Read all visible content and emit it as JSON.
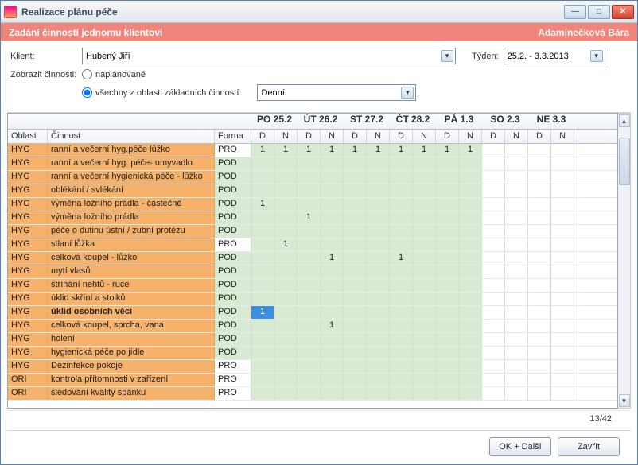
{
  "window": {
    "title": "Realizace plánu péče"
  },
  "subheader": {
    "left": "Zadání činností jednomu klientovi",
    "right": "Adamínečková Bára"
  },
  "form": {
    "client_label": "Klient:",
    "client_value": "Hubený Jiří",
    "week_label": "Týden:",
    "week_value": "25.2. - 3.3.2013",
    "show_label": "Zobrazit činnosti:",
    "radio_planned": "naplánované",
    "radio_all": "všechny z oblasti základních činností:",
    "area_value": "Denní"
  },
  "grid": {
    "days": [
      "PO 25.2",
      "ÚT 26.2",
      "ST 27.2",
      "ČT 28.2",
      "PÁ 1.3",
      "SO 2.3",
      "NE 3.3"
    ],
    "subcols": [
      "D",
      "N"
    ],
    "headers": {
      "oblast": "Oblast",
      "cinnost": "Činnost",
      "forma": "Forma"
    },
    "rows": [
      {
        "oblast": "HYG",
        "cinnost": "ranní a večerní hyg.péče lůžko",
        "forma": "PRO",
        "vals": [
          "1",
          "1",
          "1",
          "1",
          "1",
          "1",
          "1",
          "1",
          "1",
          "1",
          "",
          "",
          "",
          ""
        ]
      },
      {
        "oblast": "HYG",
        "cinnost": "ranní a večerní hyg. péče- umyvadlo",
        "forma": "POD",
        "vals": [
          "",
          "",
          "",
          "",
          "",
          "",
          "",
          "",
          "",
          "",
          "",
          "",
          "",
          ""
        ]
      },
      {
        "oblast": "HYG",
        "cinnost": "ranní a večerní hygienická péče - lůžko",
        "forma": "POD",
        "vals": [
          "",
          "",
          "",
          "",
          "",
          "",
          "",
          "",
          "",
          "",
          "",
          "",
          "",
          ""
        ]
      },
      {
        "oblast": "HYG",
        "cinnost": "oblékání / svlékání",
        "forma": "POD",
        "vals": [
          "",
          "",
          "",
          "",
          "",
          "",
          "",
          "",
          "",
          "",
          "",
          "",
          "",
          ""
        ]
      },
      {
        "oblast": "HYG",
        "cinnost": "výměna ložního prádla - částečně",
        "forma": "POD",
        "vals": [
          "1",
          "",
          "",
          "",
          "",
          "",
          "",
          "",
          "",
          "",
          "",
          "",
          "",
          ""
        ]
      },
      {
        "oblast": "HYG",
        "cinnost": "výměna ložního prádla",
        "forma": "POD",
        "vals": [
          "",
          "",
          "1",
          "",
          "",
          "",
          "",
          "",
          "",
          "",
          "",
          "",
          "",
          ""
        ]
      },
      {
        "oblast": "HYG",
        "cinnost": "péče o dutinu ústní / zubní protézu",
        "forma": "POD",
        "vals": [
          "",
          "",
          "",
          "",
          "",
          "",
          "",
          "",
          "",
          "",
          "",
          "",
          "",
          ""
        ]
      },
      {
        "oblast": "HYG",
        "cinnost": "stlaní lůžka",
        "forma": "PRO",
        "vals": [
          "",
          "1",
          "",
          "",
          "",
          "",
          "",
          "",
          "",
          "",
          "",
          "",
          "",
          ""
        ]
      },
      {
        "oblast": "HYG",
        "cinnost": "celková koupel - lůžko",
        "forma": "POD",
        "vals": [
          "",
          "",
          "",
          "1",
          "",
          "",
          "1",
          "",
          "",
          "",
          "",
          "",
          "",
          ""
        ]
      },
      {
        "oblast": "HYG",
        "cinnost": "mytí vlasů",
        "forma": "POD",
        "vals": [
          "",
          "",
          "",
          "",
          "",
          "",
          "",
          "",
          "",
          "",
          "",
          "",
          "",
          ""
        ]
      },
      {
        "oblast": "HYG",
        "cinnost": "stříhání nehtů - ruce",
        "forma": "POD",
        "vals": [
          "",
          "",
          "",
          "",
          "",
          "",
          "",
          "",
          "",
          "",
          "",
          "",
          "",
          ""
        ]
      },
      {
        "oblast": "HYG",
        "cinnost": "úklid skříní a stolků",
        "forma": "POD",
        "vals": [
          "",
          "",
          "",
          "",
          "",
          "",
          "",
          "",
          "",
          "",
          "",
          "",
          "",
          ""
        ]
      },
      {
        "oblast": "HYG",
        "cinnost": "úklid osobních věcí",
        "bold": true,
        "forma": "POD",
        "vals": [
          "1*",
          "",
          "",
          "",
          "",
          "",
          "",
          "",
          "",
          "",
          "",
          "",
          "",
          ""
        ]
      },
      {
        "oblast": "HYG",
        "cinnost": "celková koupel, sprcha, vana",
        "forma": "POD",
        "vals": [
          "",
          "",
          "",
          "1",
          "",
          "",
          "",
          "",
          "",
          "",
          "",
          "",
          "",
          ""
        ]
      },
      {
        "oblast": "HYG",
        "cinnost": "holení",
        "forma": "POD",
        "vals": [
          "",
          "",
          "",
          "",
          "",
          "",
          "",
          "",
          "",
          "",
          "",
          "",
          "",
          ""
        ]
      },
      {
        "oblast": "HYG",
        "cinnost": "hygienická péče po jídle",
        "forma": "POD",
        "vals": [
          "",
          "",
          "",
          "",
          "",
          "",
          "",
          "",
          "",
          "",
          "",
          "",
          "",
          ""
        ]
      },
      {
        "oblast": "HYG",
        "cinnost": "Dezinfekce pokoje",
        "forma": "PRO",
        "vals": [
          "",
          "",
          "",
          "",
          "",
          "",
          "",
          "",
          "",
          "",
          "",
          "",
          "",
          ""
        ]
      },
      {
        "oblast": "ORI",
        "cinnost": "kontrola přítomnosti v zařízení",
        "forma": "PRO",
        "vals": [
          "",
          "",
          "",
          "",
          "",
          "",
          "",
          "",
          "",
          "",
          "",
          "",
          "",
          ""
        ]
      },
      {
        "oblast": "ORI",
        "cinnost": "sledování kvality spánku",
        "forma": "PRO",
        "vals": [
          "",
          "",
          "",
          "",
          "",
          "",
          "",
          "",
          "",
          "",
          "",
          "",
          "",
          ""
        ]
      }
    ]
  },
  "footer": {
    "count": "13/42"
  },
  "buttons": {
    "ok": "OK + Další",
    "close": "Zavřít"
  }
}
